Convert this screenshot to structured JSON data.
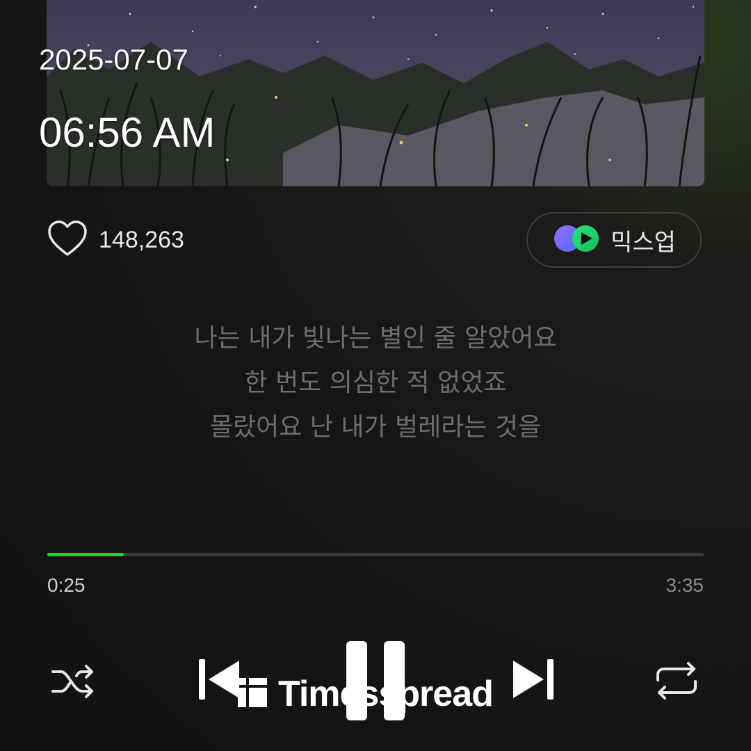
{
  "overlay": {
    "date": "2025-07-07",
    "time": "06:56 AM"
  },
  "like": {
    "icon": "heart-outline-icon",
    "count": "148,263"
  },
  "mixup": {
    "icon": "mixup-logo-icon",
    "label": "믹스업"
  },
  "lyrics": [
    "나는 내가 빛나는 별인 줄 알았어요",
    "한 번도 의심한 적 없었죠",
    "몰랐어요 난 내가 벌레라는 것을"
  ],
  "player": {
    "current_time": "0:25",
    "total_time": "3:35",
    "progress_fraction": 0.116,
    "progress_color": "#1ed52b"
  },
  "controls": {
    "shuffle_icon": "shuffle-icon",
    "prev_icon": "skip-previous-icon",
    "pause_icon": "pause-icon",
    "next_icon": "skip-next-icon",
    "repeat_icon": "repeat-icon"
  },
  "watermark": {
    "text": "Timesspread"
  }
}
